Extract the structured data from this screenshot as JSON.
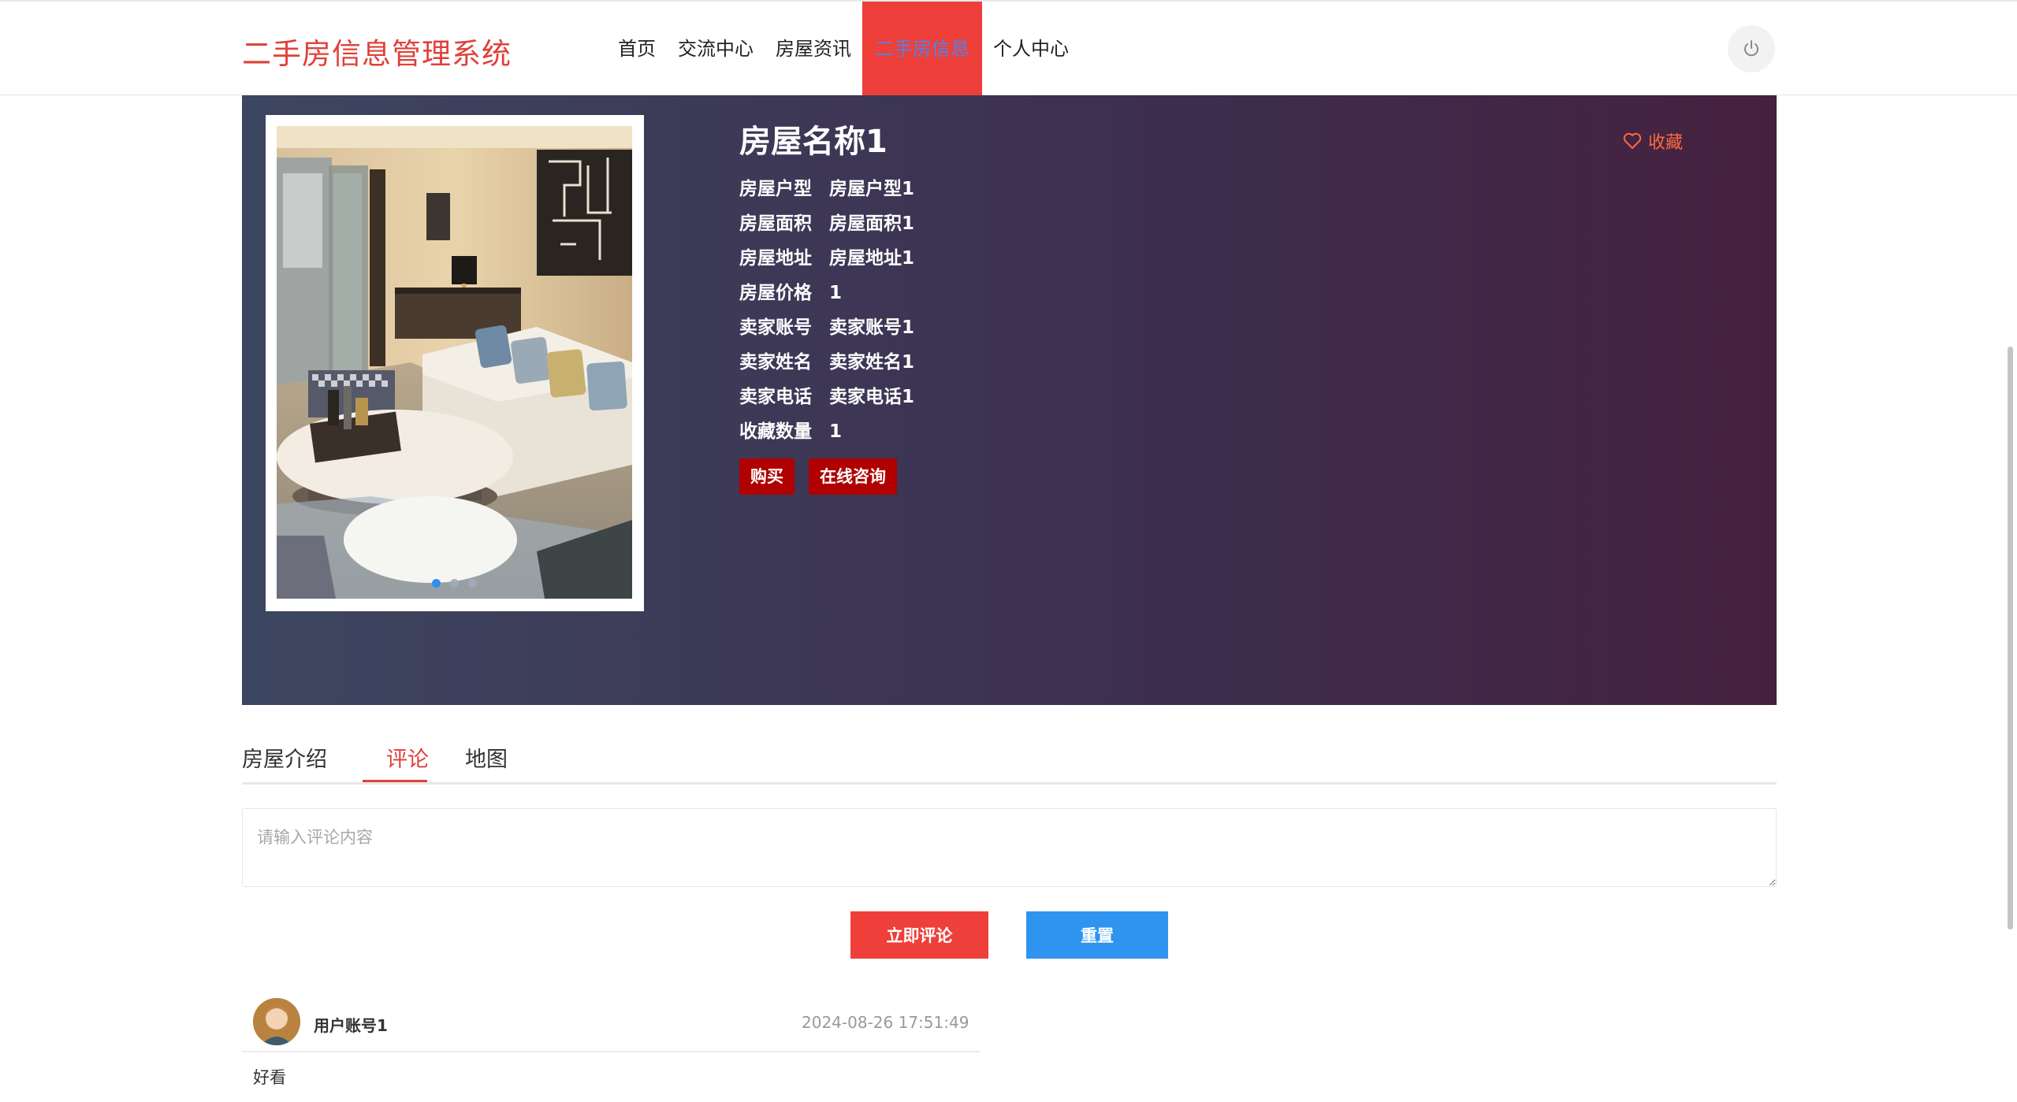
{
  "header": {
    "brand": "二手房信息管理系统",
    "nav": [
      {
        "label": "首页"
      },
      {
        "label": "交流中心"
      },
      {
        "label": "房屋资讯"
      },
      {
        "label": "二手房信息",
        "active": true
      },
      {
        "label": "个人中心"
      }
    ],
    "power_icon": "power-icon"
  },
  "detail": {
    "title": "房屋名称1",
    "favorite_label": "收藏",
    "fields": [
      {
        "key": "房屋户型",
        "value": "房屋户型1"
      },
      {
        "key": "房屋面积",
        "value": "房屋面积1"
      },
      {
        "key": "房屋地址",
        "value": "房屋地址1"
      },
      {
        "key": "房屋价格",
        "value": "1"
      },
      {
        "key": "卖家账号",
        "value": "卖家账号1"
      },
      {
        "key": "卖家姓名",
        "value": "卖家姓名1"
      },
      {
        "key": "卖家电话",
        "value": "卖家电话1"
      },
      {
        "key": "收藏数量",
        "value": "1"
      }
    ],
    "buy_label": "购买",
    "consult_label": "在线咨询",
    "carousel": {
      "count": 3,
      "active_index": 0
    }
  },
  "tabs": [
    {
      "label": "房屋介绍"
    },
    {
      "label": "评论",
      "active": true
    },
    {
      "label": "地图"
    }
  ],
  "comment_form": {
    "placeholder": "请输入评论内容",
    "value": "",
    "submit_label": "立即评论",
    "reset_label": "重置"
  },
  "comments": [
    {
      "user": "用户账号1",
      "time": "2024-08-26 17:51:49",
      "content": "好看"
    }
  ],
  "colors": {
    "brand_red": "#e0403a",
    "nav_active_bg": "#ee3f3a",
    "nav_active_text": "#4f83e8",
    "action_btn": "#b00000",
    "reset_btn": "#2f93f0",
    "favorite": "#ff6a3d"
  }
}
